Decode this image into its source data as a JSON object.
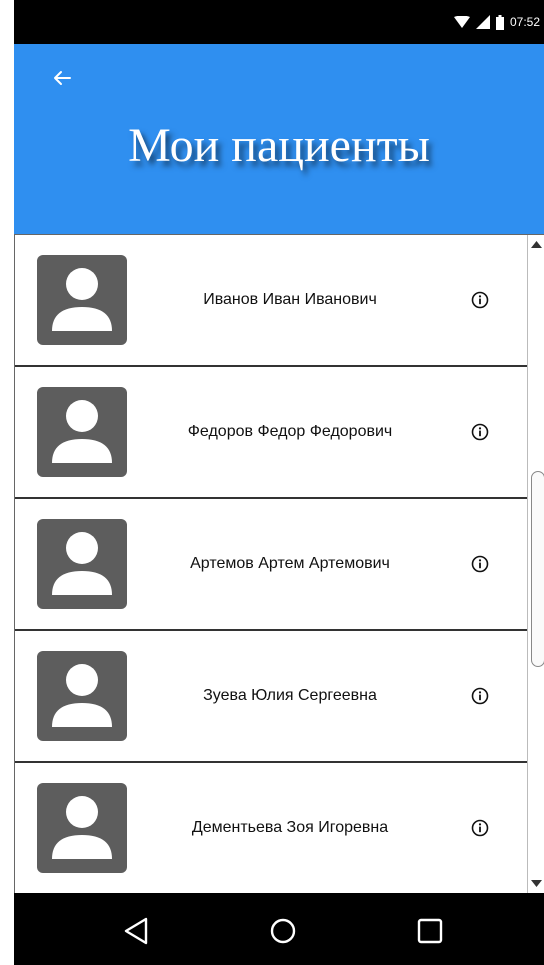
{
  "status_bar": {
    "time": "07:52",
    "icons": [
      "wifi-icon",
      "signal-icon",
      "battery-icon"
    ]
  },
  "app_bar": {
    "title": "Мои пациенты",
    "back_icon": "arrow-left-icon",
    "color": "#2f8ff0"
  },
  "patients": [
    {
      "name": "Иванов Иван Иванович"
    },
    {
      "name": "Федоров Федор Федорович"
    },
    {
      "name": "Артемов Артем Артемович"
    },
    {
      "name": "Зуева Юлия Сергеевна"
    },
    {
      "name": "Дементьева Зоя Игоревна"
    }
  ],
  "item_icons": {
    "avatar": "user-avatar-icon",
    "info": "info-icon"
  },
  "nav_bar": {
    "icons": [
      "nav-back-icon",
      "nav-home-icon",
      "nav-recents-icon"
    ]
  }
}
